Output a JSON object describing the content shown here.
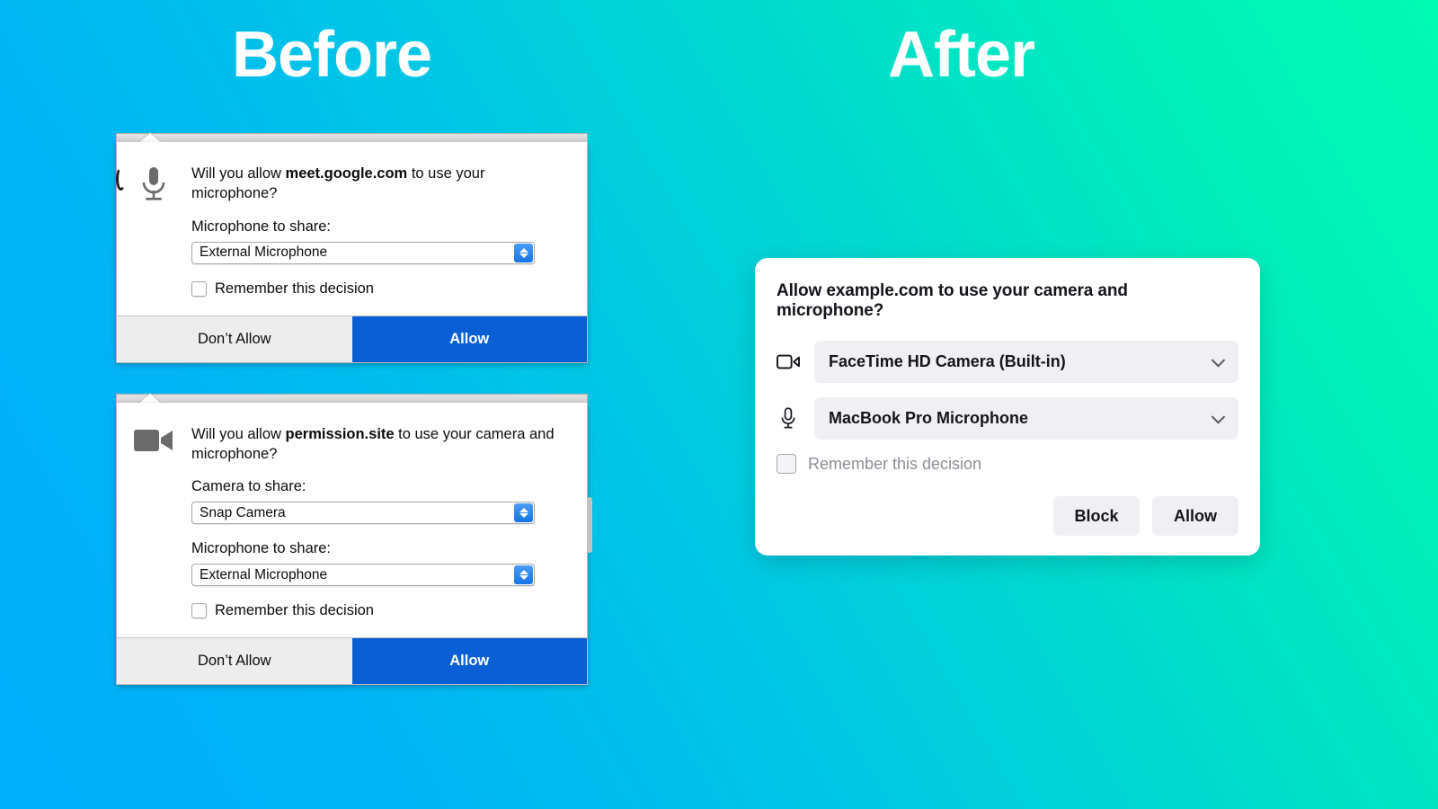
{
  "headings": {
    "before": "Before",
    "after": "After"
  },
  "colors": {
    "gradient_start": "#00AEFA",
    "gradient_end": "#00FAB2",
    "legacy_allow_button": "#0B5FD4",
    "legacy_deny_button": "#EDEDED",
    "modern_field": "#F0F0F4",
    "modern_text": "#15141A",
    "modern_muted_text": "#8D8D96"
  },
  "before": {
    "popups": [
      {
        "icon": "microphone-icon",
        "question_prefix": "Will you allow ",
        "question_origin": "meet.google.com",
        "question_suffix": " to use your microphone?",
        "fields": [
          {
            "label": "Microphone to share:",
            "value": "External Microphone",
            "name": "microphone-select"
          }
        ],
        "remember_label": "Remember this decision",
        "deny_label": "Don’t Allow",
        "allow_label": "Allow"
      },
      {
        "icon": "video-camera-icon",
        "question_prefix": "Will you allow ",
        "question_origin": "permission.site",
        "question_suffix": " to use your camera and microphone?",
        "fields": [
          {
            "label": "Camera to share:",
            "value": "Snap Camera",
            "name": "camera-select"
          },
          {
            "label": "Microphone to share:",
            "value": "External Microphone",
            "name": "microphone-select"
          }
        ],
        "remember_label": "Remember this decision",
        "deny_label": "Don’t Allow",
        "allow_label": "Allow"
      }
    ]
  },
  "after": {
    "title": "Allow example.com to use your camera and microphone?",
    "rows": [
      {
        "icon": "video-camera-icon",
        "value": "FaceTime HD Camera (Built-in)",
        "name": "camera-select"
      },
      {
        "icon": "microphone-icon",
        "value": "MacBook Pro Microphone",
        "name": "microphone-select"
      }
    ],
    "remember_label": "Remember this decision",
    "block_label": "Block",
    "allow_label": "Allow"
  }
}
